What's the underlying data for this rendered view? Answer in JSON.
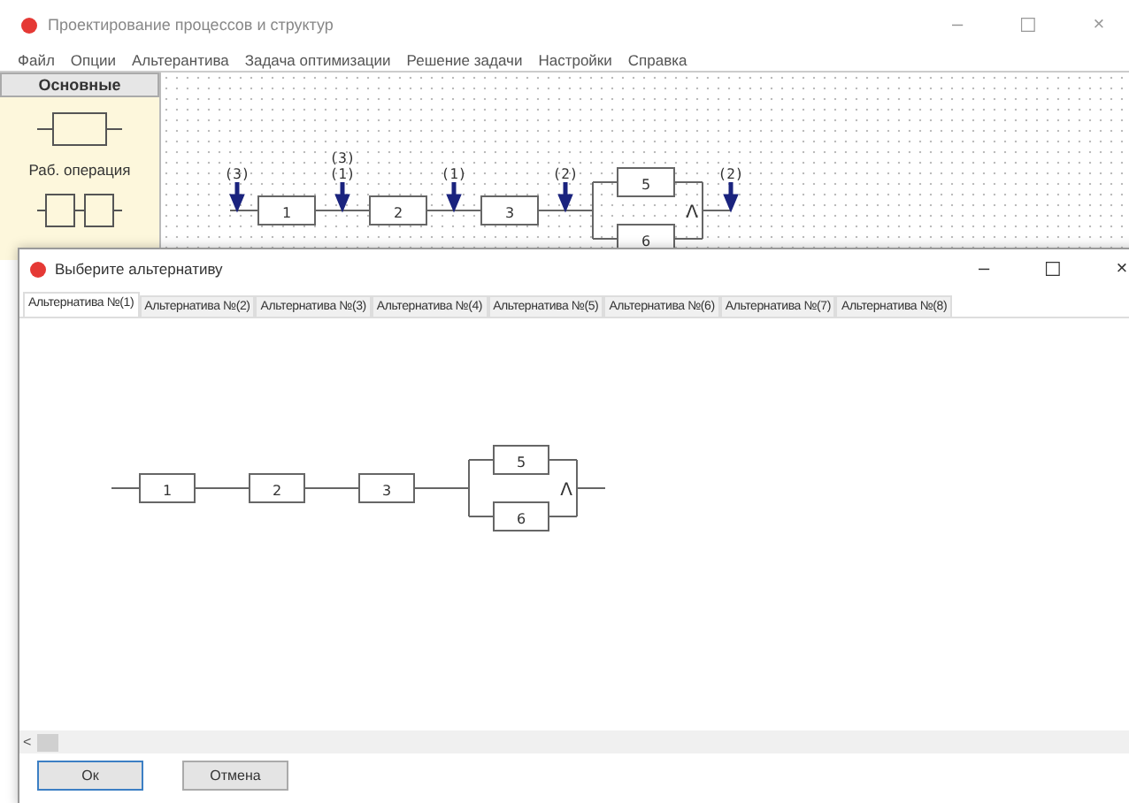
{
  "main_window": {
    "title": "Проектирование процессов и структур",
    "controls": [
      "–",
      "☐",
      "×"
    ],
    "menu": [
      "Файл",
      "Опции",
      "Альтерантива",
      "Задача оптимизации",
      "Решение задачи",
      "Настройки",
      "Справка"
    ],
    "palette": {
      "header": "Основные",
      "items": [
        {
          "kind": "single",
          "label": "Раб. операция"
        },
        {
          "kind": "double"
        }
      ]
    },
    "diagram": {
      "series": [
        "1",
        "2",
        "3"
      ],
      "parallel": [
        "5",
        "6"
      ],
      "join": "Λ",
      "markers": [
        {
          "labels": [
            "(3)"
          ]
        },
        {
          "labels": [
            "(3)",
            "(1)"
          ]
        },
        {
          "labels": [
            "(1)"
          ]
        },
        {
          "labels": [
            "(2)"
          ]
        },
        {
          "labels": [
            "(2)"
          ]
        }
      ]
    }
  },
  "dialog": {
    "title": "Выберите альтернативу",
    "controls": [
      "–",
      "☐",
      "×"
    ],
    "tabs": [
      {
        "label": "Альтернатива №(1)",
        "selected": true
      },
      {
        "label": "Альтернатива №(2)",
        "selected": false
      },
      {
        "label": "Альтернатива №(3)",
        "selected": false
      },
      {
        "label": "Альтернатива №(4)",
        "selected": false
      },
      {
        "label": "Альтернатива №(5)",
        "selected": false
      },
      {
        "label": "Альтернатива №(6)",
        "selected": false
      },
      {
        "label": "Альтернатива №(7)",
        "selected": false
      },
      {
        "label": "Альтернатива №(8)",
        "selected": false
      }
    ],
    "diagram": {
      "series": [
        "1",
        "2",
        "3"
      ],
      "parallel": [
        "5",
        "6"
      ],
      "join": "Λ"
    },
    "scroll_arrow": "<",
    "buttons": [
      {
        "label": "Ок",
        "selected": true
      },
      {
        "label": "Отмена",
        "selected": false
      }
    ]
  }
}
